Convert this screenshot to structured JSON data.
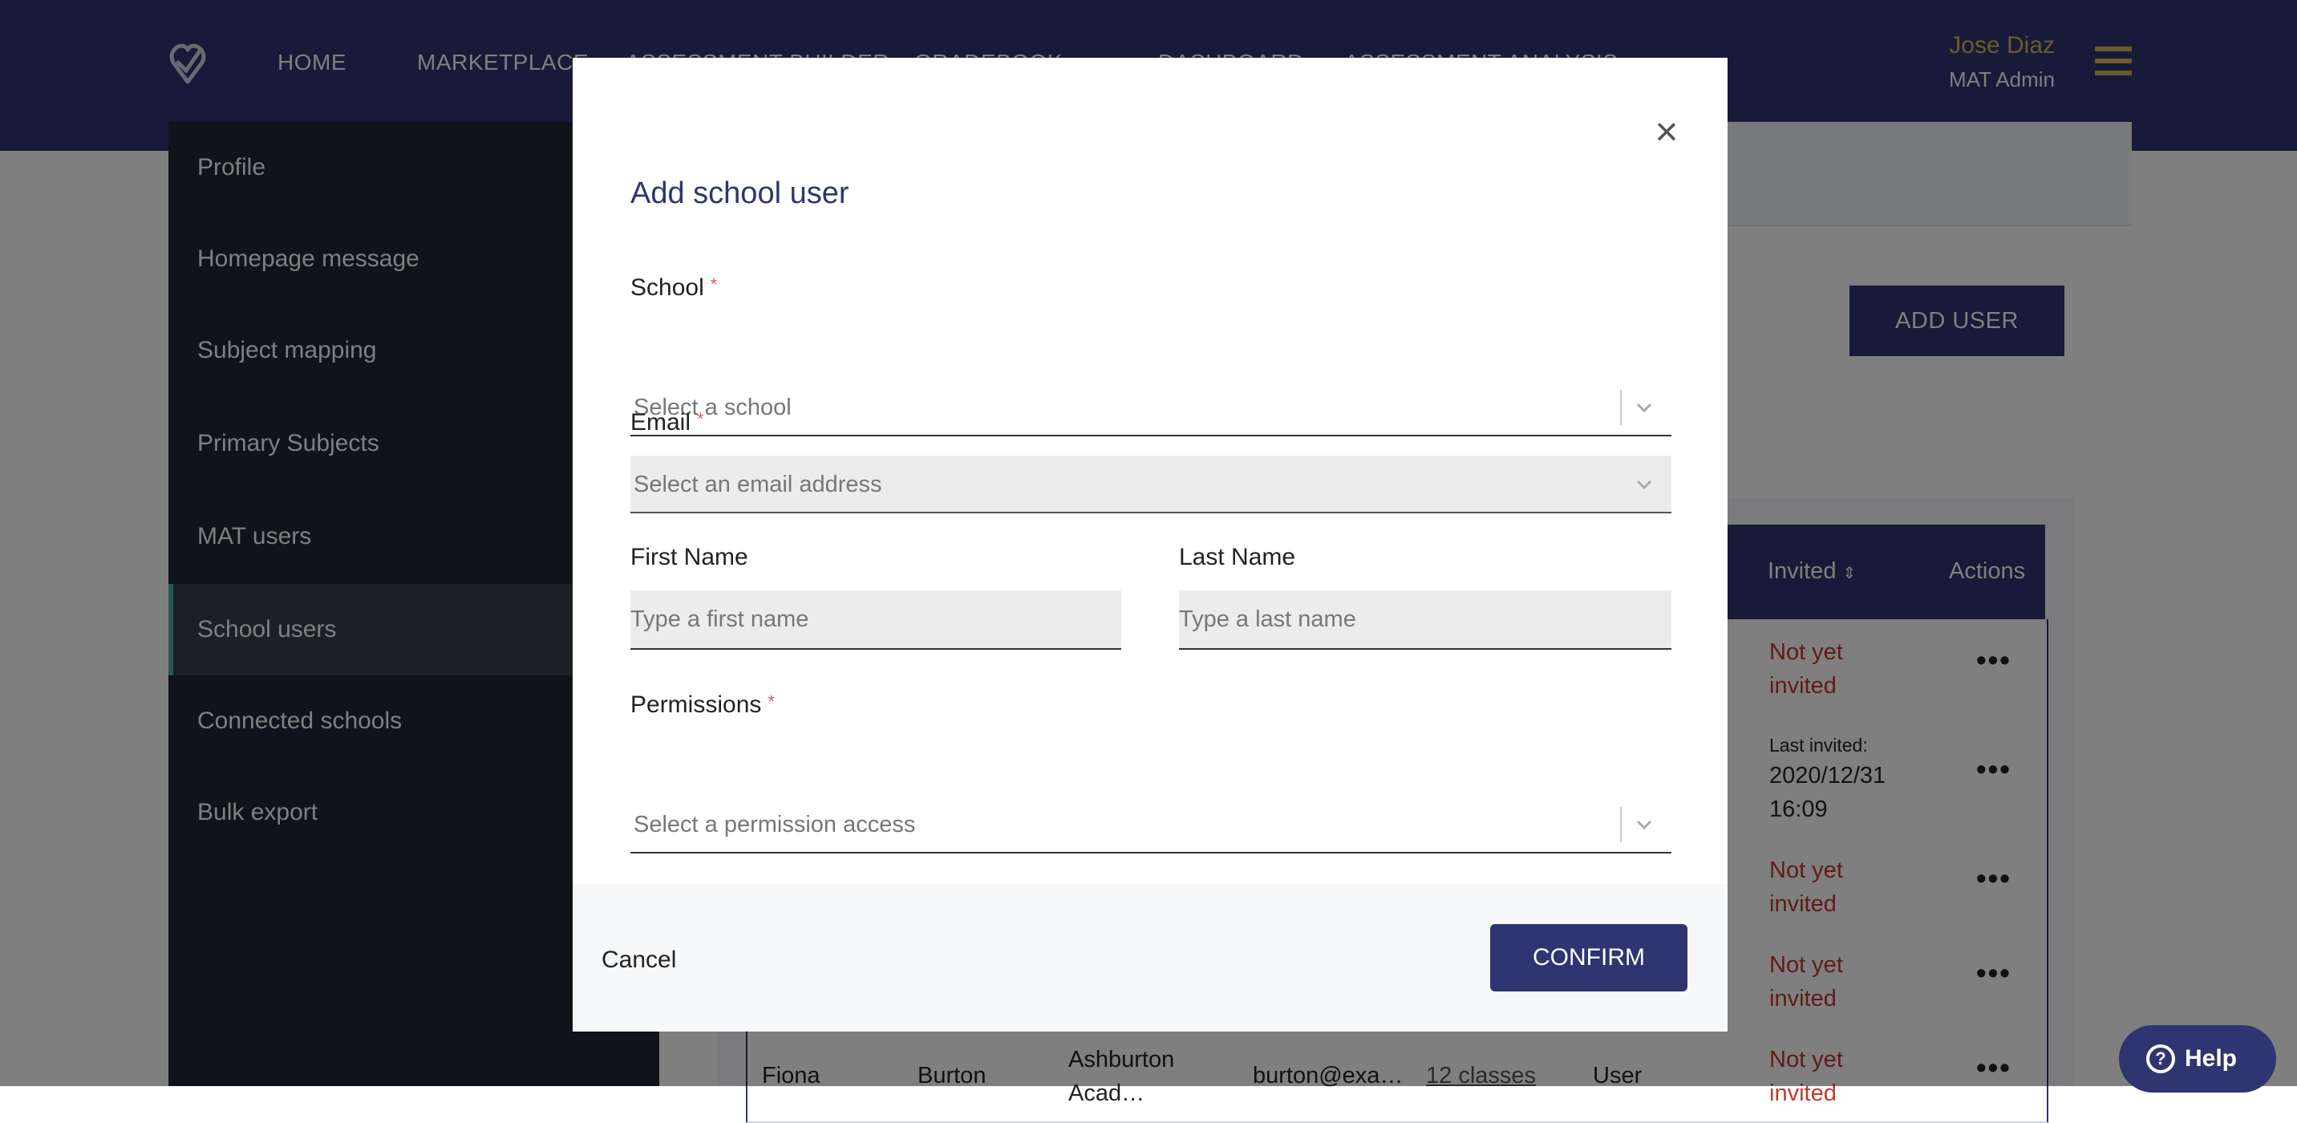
{
  "nav": {
    "items": [
      "HOME",
      "MARKETPLACE",
      "ASSESSMENT BUILDER",
      "GRADEBOOK",
      "DASHBOARD",
      "ASSESSMENT ANALYSIS"
    ]
  },
  "user": {
    "name": "Jose Diaz",
    "role": "MAT Admin"
  },
  "sidebar": {
    "items": [
      {
        "label": "Profile"
      },
      {
        "label": "Homepage message"
      },
      {
        "label": "Subject mapping"
      },
      {
        "label": "Primary Subjects"
      },
      {
        "label": "MAT users"
      },
      {
        "label": "School users",
        "active": true
      },
      {
        "label": "Connected schools"
      },
      {
        "label": "Bulk export"
      }
    ]
  },
  "main": {
    "add_user_label": "ADD USER",
    "table": {
      "headers": {
        "invited": "Invited",
        "actions": "Actions",
        "sort_icon": "sort-icon"
      },
      "rows": [
        {
          "invited": "Not yet invited"
        },
        {
          "last_invited_label": "Last invited:",
          "invited_date": "2020/12/31",
          "invited_time": "16:09"
        },
        {
          "invited": "Not yet invited"
        },
        {
          "invited": "Not yet invited"
        },
        {
          "first": "Fiona",
          "last": "Burton",
          "school": "Ashburton Acad…",
          "email": "burton@exa…",
          "classes": "12 classes",
          "permission": "User",
          "invited": "Not yet invited"
        }
      ]
    }
  },
  "modal": {
    "title": "Add school user",
    "school": {
      "label": "School",
      "placeholder": "Select a school"
    },
    "email": {
      "label": "Email",
      "placeholder": "Select an email address"
    },
    "first_name": {
      "label": "First Name",
      "placeholder": "Type a first name"
    },
    "last_name": {
      "label": "Last Name",
      "placeholder": "Type a last name"
    },
    "permissions": {
      "label": "Permissions",
      "placeholder": "Select a permission access"
    },
    "required_mark": "*",
    "cancel_label": "Cancel",
    "confirm_label": "CONFIRM",
    "close_glyph": "×"
  },
  "help": {
    "label": "Help",
    "glyph": "?"
  },
  "colors": {
    "primary": "#2e3570",
    "accent": "#d8b659",
    "sidebar": "#232734",
    "active_marker": "#4bb392",
    "error": "#c0392b"
  }
}
